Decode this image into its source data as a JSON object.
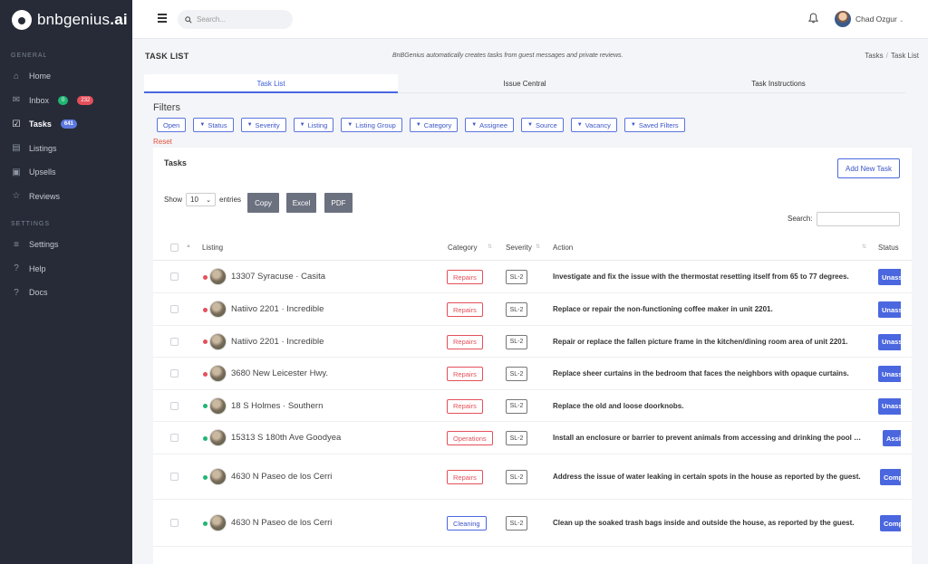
{
  "brand": {
    "name_light": "bnbgenius",
    "name_bold": ".ai"
  },
  "sidebar": {
    "general_label": "GENERAL",
    "settings_label": "SETTINGS",
    "items": [
      {
        "label": "Home",
        "icon": "home-icon"
      },
      {
        "label": "Inbox",
        "icon": "inbox-icon",
        "badge_green": "0",
        "badge_red": "232"
      },
      {
        "label": "Tasks",
        "icon": "tasks-icon",
        "badge_blue": "641"
      },
      {
        "label": "Listings",
        "icon": "listings-icon"
      },
      {
        "label": "Upsells",
        "icon": "upsells-icon"
      },
      {
        "label": "Reviews",
        "icon": "star-icon"
      }
    ],
    "settings_items": [
      {
        "label": "Settings",
        "icon": "sliders-icon"
      },
      {
        "label": "Help",
        "icon": "help-icon"
      },
      {
        "label": "Docs",
        "icon": "docs-icon"
      }
    ]
  },
  "topbar": {
    "search_placeholder": "Search...",
    "user_name": "Chad Ozgur"
  },
  "page": {
    "title": "TASK LIST",
    "note": "BnBGenius automatically creates tasks from guest messages and private reviews.",
    "breadcrumb": [
      "Tasks",
      "Task List"
    ]
  },
  "tabs": [
    "Task List",
    "Issue Central",
    "Task Instructions"
  ],
  "filters": {
    "title": "Filters",
    "open": "Open",
    "buttons": [
      "Status",
      "Severity",
      "Listing",
      "Listing Group",
      "Category",
      "Assignee",
      "Source",
      "Vacancy",
      "Saved Filters"
    ],
    "reset": "Reset"
  },
  "card": {
    "title": "Tasks",
    "add_button": "Add New Task",
    "show_label": "Show",
    "entries_value": "10",
    "entries_label": "entries",
    "export": [
      "Copy",
      "Excel",
      "PDF"
    ],
    "search_label": "Search:"
  },
  "table": {
    "headers": {
      "listing": "Listing",
      "category": "Category",
      "severity": "Severity",
      "action": "Action",
      "status": "Status"
    },
    "rows": [
      {
        "dot": "red",
        "listing": "13307 Syracuse · Casita",
        "category": "Repairs",
        "severity": "SL-2",
        "action": "Investigate and fix the issue with the thermostat resetting itself from 65 to 77 degrees.",
        "status": "Unassigned"
      },
      {
        "dot": "red",
        "listing": "Natiivo 2201 · Incredible",
        "category": "Repairs",
        "severity": "SL-2",
        "action": "Replace or repair the non-functioning coffee maker in unit 2201.",
        "status": "Unassigned"
      },
      {
        "dot": "red",
        "listing": "Natiivo 2201 · Incredible",
        "category": "Repairs",
        "severity": "SL-2",
        "action": "Repair or replace the fallen picture frame in the kitchen/dining room area of unit 2201.",
        "status": "Unassigned"
      },
      {
        "dot": "red",
        "listing": "3680 New Leicester Hwy.",
        "category": "Repairs",
        "severity": "SL-2",
        "action": "Replace sheer curtains in the bedroom that faces the neighbors with opaque curtains.",
        "status": "Unassigned"
      },
      {
        "dot": "green",
        "listing": "18 S Holmes · Southern",
        "category": "Repairs",
        "severity": "SL-2",
        "action": "Replace the old and loose doorknobs.",
        "status": "Unassigned"
      },
      {
        "dot": "green",
        "listing": "15313 S 180th Ave Goodyea",
        "category": "Operations",
        "severity": "SL-2",
        "action": "Install an enclosure or barrier to prevent animals from accessing and drinking the pool water.",
        "status": "Assigned"
      },
      {
        "dot": "green",
        "listing": "4630 N Paseo de los Cerri",
        "category": "Repairs",
        "severity": "SL-2",
        "action": "Address the issue of water leaking in certain spots in the house as reported by the guest.",
        "status": "Completed"
      },
      {
        "dot": "green",
        "listing": "4630 N Paseo de los Cerri",
        "category": "Cleaning",
        "severity": "SL-2",
        "action": "Clean up the soaked trash bags inside and outside the house, as reported by the guest.",
        "status": "Completed"
      }
    ]
  },
  "colors": {
    "sidebar": "#262b37",
    "accent": "#4a67e0",
    "danger": "#e4505a",
    "success": "#22b573"
  }
}
